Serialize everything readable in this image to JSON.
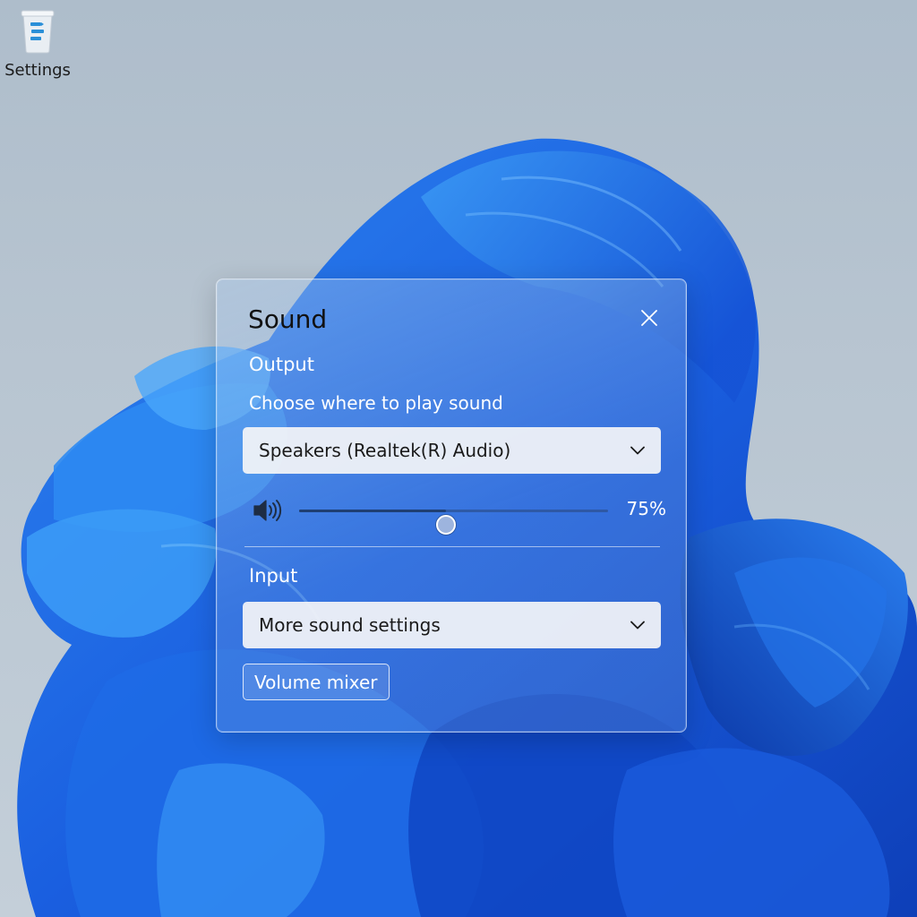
{
  "desktop": {
    "icons": [
      {
        "label": "Settings",
        "icon": "recycle-bin-icon"
      }
    ]
  },
  "flyout": {
    "title": "Sound",
    "close_icon": "close-icon",
    "output": {
      "section_label": "Output",
      "subtitle": "Choose where to play sound",
      "device_selected": "Speakers (Realtek(R) Audio)"
    },
    "volume": {
      "icon": "speaker-icon",
      "level_percent": 75,
      "display": "75%"
    },
    "input": {
      "section_label": "Input",
      "dropdown_selected": "More sound settings"
    },
    "mixer_button_label": "Volume mixer"
  },
  "colors": {
    "accent": "#1f3f73",
    "wallpaper_blue": "#1e63e0",
    "desktop_bg": "#b8c5d1"
  }
}
